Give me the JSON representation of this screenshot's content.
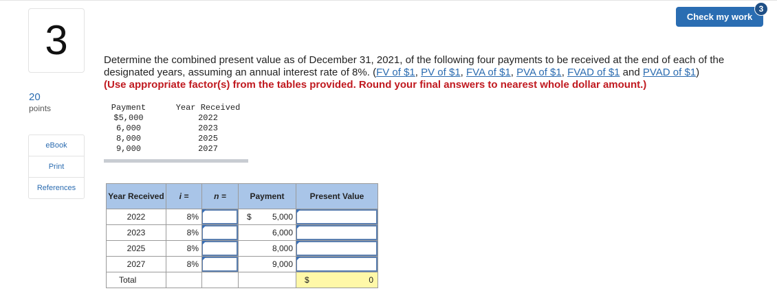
{
  "question_number": "3",
  "points": {
    "value": "20",
    "label": "points"
  },
  "side_links": [
    "eBook",
    "Print",
    "References"
  ],
  "check_button": {
    "label": "Check my work",
    "badge": "3"
  },
  "question": {
    "text": "Determine the combined present value as of December 31, 2021, of the following four payments to be received at the end of each of the designated years, assuming an annual interest rate of 8%.",
    "links_prefix": "(",
    "links": [
      "FV of $1",
      "PV of $1",
      "FVA of $1",
      "PVA of $1",
      "FVAD of $1",
      "PVAD of $1"
    ],
    "links_and": "and",
    "links_suffix": ")",
    "instruction": "(Use appropriate factor(s) from the tables provided. Round your final answers to nearest whole dollar amount.)"
  },
  "given": {
    "headers": [
      "Payment",
      "Year Received"
    ],
    "rows": [
      [
        "$5,000",
        "2022"
      ],
      [
        "6,000",
        "2023"
      ],
      [
        "8,000",
        "2025"
      ],
      [
        "9,000",
        "2027"
      ]
    ]
  },
  "work_table": {
    "headers": {
      "year": "Year Received",
      "i": "i =",
      "n": "n =",
      "payment": "Payment",
      "pv": "Present Value"
    },
    "rows": [
      {
        "year": "2022",
        "i": "8%",
        "n": "",
        "dollar": "$",
        "payment": "5,000",
        "pv": ""
      },
      {
        "year": "2023",
        "i": "8%",
        "n": "",
        "dollar": "",
        "payment": "6,000",
        "pv": ""
      },
      {
        "year": "2025",
        "i": "8%",
        "n": "",
        "dollar": "",
        "payment": "8,000",
        "pv": ""
      },
      {
        "year": "2027",
        "i": "8%",
        "n": "",
        "dollar": "",
        "payment": "9,000",
        "pv": ""
      }
    ],
    "total": {
      "label": "Total",
      "dollar": "$",
      "value": "0"
    }
  },
  "colors": {
    "link": "#2a6bb0",
    "button": "#2a6db2",
    "instruction": "#c0191f",
    "header_bg": "#a9c5e8",
    "total_bg": "#fff8a8"
  }
}
